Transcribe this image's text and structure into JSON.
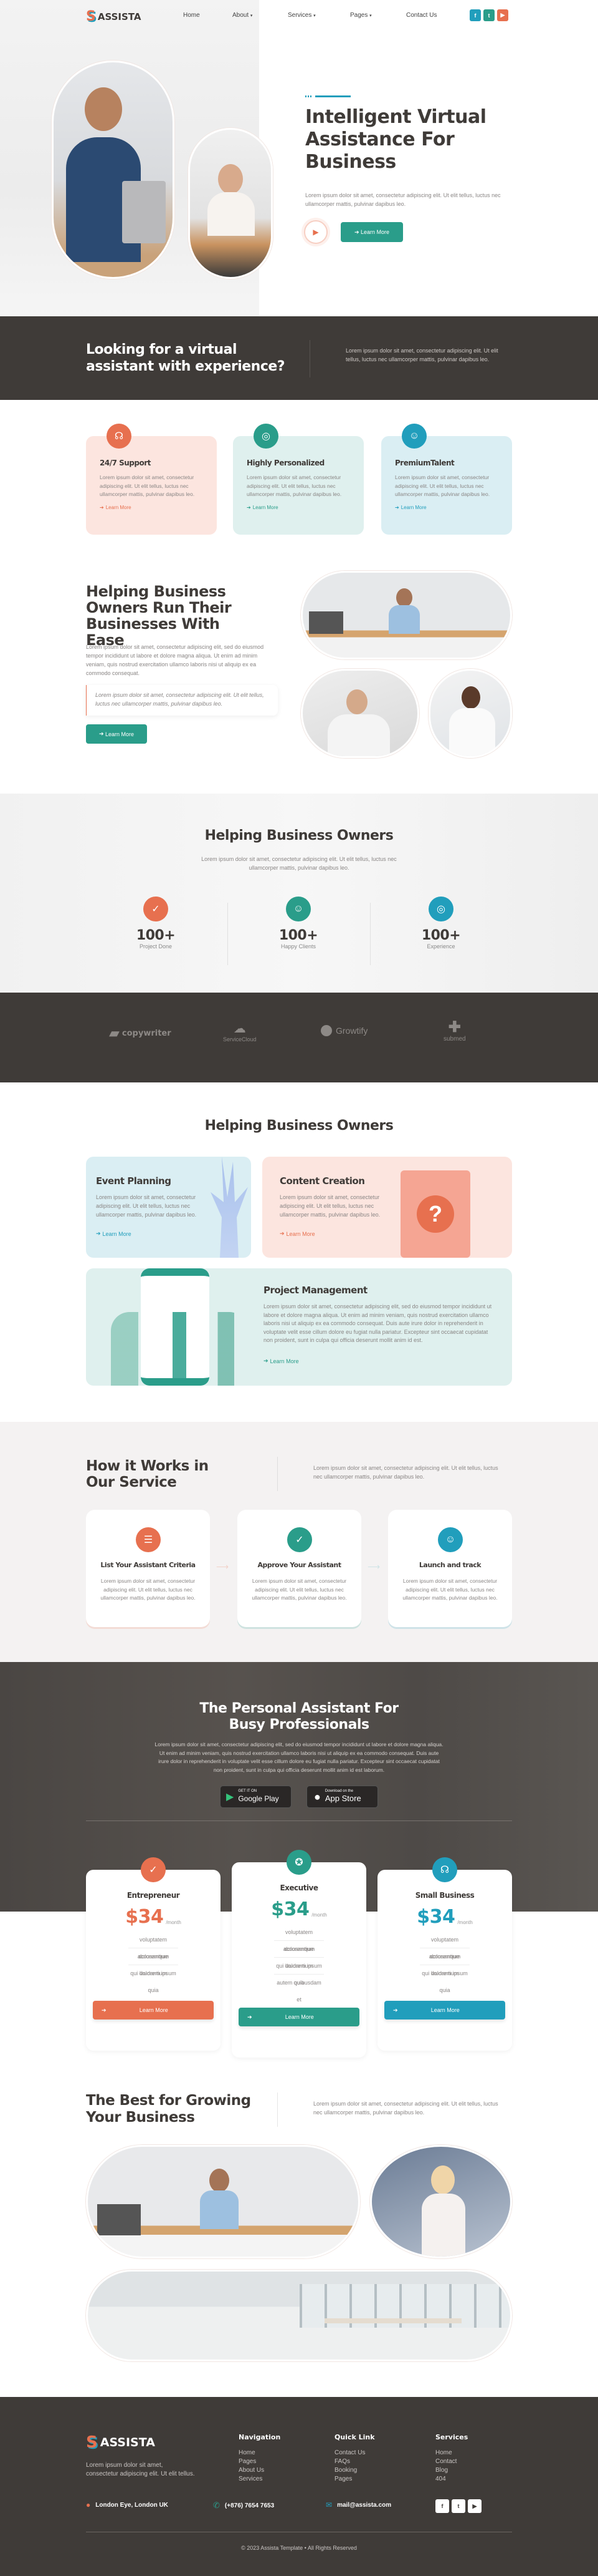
{
  "colors": {
    "orange": "#E7704F",
    "teal": "#2A9D8A",
    "blue": "#219EBC",
    "dark": "#3F3B38"
  },
  "brand": "ASSISTA",
  "nav": {
    "items": [
      "Home",
      "About",
      "Services",
      "Pages",
      "Contact Us"
    ],
    "social": [
      "facebook-icon",
      "twitter-icon",
      "youtube-icon"
    ]
  },
  "hero": {
    "title": "Intelligent Virtual Assistance For Business",
    "text": "Lorem ipsum dolor sit amet, consectetur adipiscing elit. Ut elit tellus, luctus nec ullamcorper mattis, pulvinar dapibus leo.",
    "cta": "Learn More"
  },
  "band": {
    "title": "Looking for a virtual assistant with experience?",
    "text": "Lorem ipsum dolor sit amet, consectetur adipiscing elit. Ut elit tellus, luctus nec ullamcorper mattis, pulvinar dapibus leo."
  },
  "features": [
    {
      "title": "24/7 Support",
      "text": "Lorem ipsum dolor sit amet, consectetur adipiscing elit. Ut elit tellus, luctus nec ullamcorper mattis, pulvinar dapibus leo.",
      "link": "Learn More",
      "icon": "headset-icon"
    },
    {
      "title": "Highly Personalized",
      "text": "Lorem ipsum dolor sit amet, consectetur adipiscing elit. Ut elit tellus, luctus nec ullamcorper mattis, pulvinar dapibus leo.",
      "link": "Learn More",
      "icon": "target-icon"
    },
    {
      "title": "PremiumTalent",
      "text": "Lorem ipsum dolor sit amet, consectetur adipiscing elit. Ut elit tellus, luctus nec ullamcorper mattis, pulvinar dapibus leo.",
      "link": "Learn More",
      "icon": "users-icon"
    }
  ],
  "about": {
    "title": "Helping Business Owners Run Their Businesses With Ease",
    "text": "Lorem ipsum dolor sit amet, consectetur adipiscing elit, sed do eiusmod tempor incididunt ut labore et dolore magna aliqua. Ut enim ad minim veniam, quis nostrud exercitation ullamco laboris nisi ut aliquip ex ea commodo consequat.",
    "quote": "Lorem ipsum dolor sit amet, consectetur adipiscing elit. Ut elit tellus, luctus nec ullamcorper mattis, pulvinar dapibus leo.",
    "cta": "Learn More"
  },
  "stats": {
    "title": "Helping Business Owners",
    "text": "Lorem ipsum dolor sit amet, consectetur adipiscing elit. Ut elit tellus, luctus nec ullamcorper mattis, pulvinar dapibus leo.",
    "items": [
      {
        "value": "100+",
        "label": "Project Done"
      },
      {
        "value": "100+",
        "label": "Happy Clients"
      },
      {
        "value": "100+",
        "label": "Experience"
      }
    ]
  },
  "logos": [
    "copywriter",
    "ServiceCloud",
    "Growtify",
    "submed"
  ],
  "services": {
    "title": "Helping Business Owners",
    "items": [
      {
        "title": "Event Planning",
        "text": "Lorem ipsum dolor sit amet, consectetur adipiscing elit. Ut elit tellus, luctus nec ullamcorper mattis, pulvinar dapibus leo.",
        "link": "Learn More"
      },
      {
        "title": "Content Creation",
        "text": "Lorem ipsum dolor sit amet, consectetur adipiscing elit. Ut elit tellus, luctus nec ullamcorper mattis, pulvinar dapibus leo.",
        "link": "Learn More"
      },
      {
        "title": "Project Management",
        "text": "Lorem ipsum dolor sit amet, consectetur adipiscing elit, sed do eiusmod tempor incididunt ut labore et dolore magna aliqua. Ut enim ad minim veniam, quis nostrud exercitation ullamco laboris nisi ut aliquip ex ea commodo consequat. Duis aute irure dolor in reprehenderit in voluptate velit esse cillum dolore eu fugiat nulla pariatur. Excepteur sint occaecat cupidatat non proident, sunt in culpa qui officia deserunt mollit anim id est.",
        "link": "Learn More"
      }
    ]
  },
  "how": {
    "title": "How it Works in Our Service",
    "text": "Lorem ipsum dolor sit amet, consectetur adipiscing elit. Ut elit tellus, luctus nec ullamcorper mattis, pulvinar dapibus leo.",
    "steps": [
      {
        "title": "List Your Assistant Criteria",
        "text": "Lorem ipsum dolor sit amet, consectetur adipiscing elit. Ut elit tellus, luctus nec ullamcorper mattis, pulvinar dapibus leo.",
        "icon": "checklist-icon"
      },
      {
        "title": "Approve Your Assistant",
        "text": "Lorem ipsum dolor sit amet, consectetur adipiscing elit. Ut elit tellus, luctus nec ullamcorper mattis, pulvinar dapibus leo.",
        "icon": "check-circle-icon"
      },
      {
        "title": "Launch and track",
        "text": "Lorem ipsum dolor sit amet, consectetur adipiscing elit. Ut elit tellus, luctus nec ullamcorper mattis, pulvinar dapibus leo.",
        "icon": "person-icon"
      }
    ]
  },
  "app": {
    "title": "The Personal Assistant For Busy Professionals",
    "text": "Lorem ipsum dolor sit amet, consectetur adipiscing elit, sed do eiusmod tempor incididunt ut labore et dolore magna aliqua. Ut enim ad minim veniam, quis nostrud exercitation ullamco laboris nisi ut aliquip ex ea commodo consequat. Duis aute irure dolor in reprehenderit in voluptate velit esse cillum dolore eu fugiat nulla pariatur. Excepteur sint occaecat cupidatat non proident, sunt in culpa qui officia deserunt mollit anim id est laborum.",
    "google_small": "GET IT ON",
    "google": "Google Play",
    "apple_small": "Download on the",
    "apple": "App Store"
  },
  "pricing": [
    {
      "name": "Entrepreneur",
      "price": "$34",
      "period": "/month",
      "features": [
        "voluptatem accusantium",
        "doloremque laudantium",
        "qui dolorem ipsum quia"
      ],
      "cta": "Learn More"
    },
    {
      "name": "Executive",
      "price": "$34",
      "period": "/month",
      "features": [
        "voluptatem accusantium",
        "doloremque laudantium",
        "qui dolorem ipsum quia",
        "autem quibusdam et"
      ],
      "cta": "Learn More"
    },
    {
      "name": "Small Business",
      "price": "$34",
      "period": "/month",
      "features": [
        "voluptatem accusantium",
        "doloremque laudantium",
        "qui dolorem ipsum quia"
      ],
      "cta": "Learn More"
    }
  ],
  "growth": {
    "title": "The Best for Growing Your Business",
    "text": "Lorem ipsum dolor sit amet, consectetur adipiscing elit. Ut elit tellus, luctus nec ullamcorper mattis, pulvinar dapibus leo."
  },
  "footer": {
    "desc": "Lorem ipsum dolor sit amet, consectetur adipiscing elit. Ut elit tellus.",
    "cols": [
      {
        "title": "Navigation",
        "links": [
          "Home",
          "Pages",
          "About Us",
          "Services"
        ]
      },
      {
        "title": "Quick Link",
        "links": [
          "Contact Us",
          "FAQs",
          "Booking",
          "Pages"
        ]
      },
      {
        "title": "Services",
        "links": [
          "Home",
          "Contact",
          "Blog",
          "404"
        ]
      }
    ],
    "address": "London Eye, London UK",
    "phone": "(+876) 7654 7653",
    "email": "mail@assista.com",
    "copyright": "© 2023 Assista Template • All Rights Reserved"
  }
}
